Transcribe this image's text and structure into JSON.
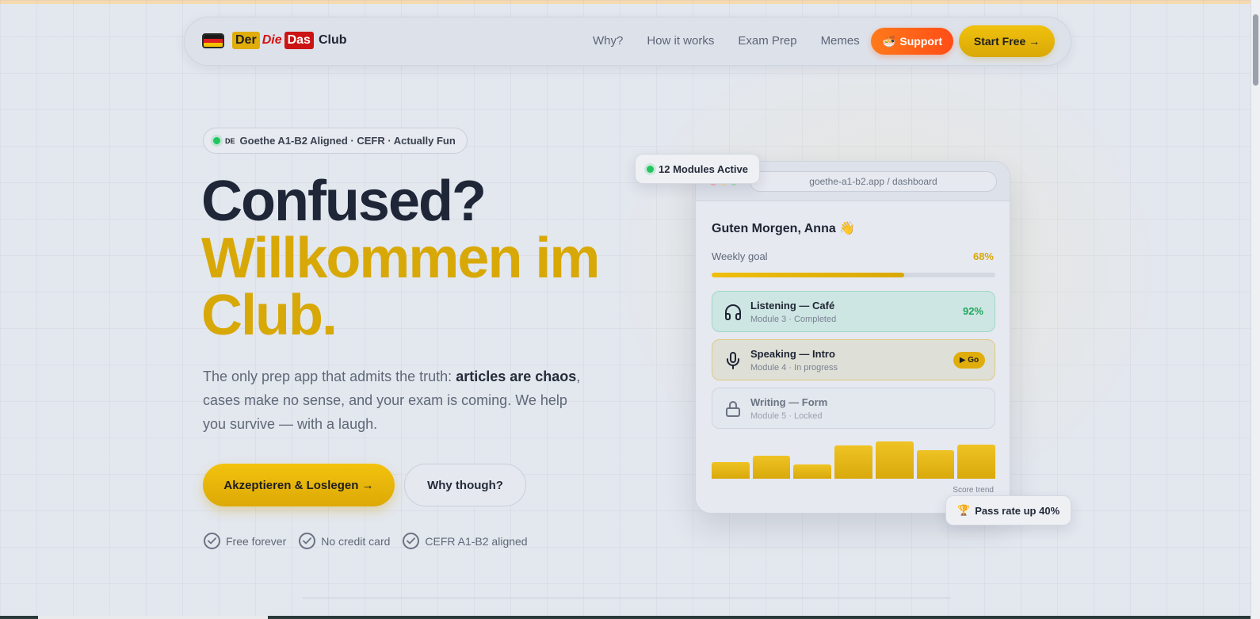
{
  "brand": {
    "der": "Der",
    "die": "Die",
    "das": "Das",
    "club": "Club",
    "flag_colors": [
      "#1a1a1a",
      "#dd1f1f",
      "#f2c100"
    ]
  },
  "nav": {
    "links": [
      {
        "label": "Why?"
      },
      {
        "label": "How it works"
      },
      {
        "label": "Exam Prep"
      },
      {
        "label": "Memes"
      }
    ],
    "support_icon": "🍜",
    "support_label": "Support",
    "start_label": "Start Free →"
  },
  "hero": {
    "pill_flag": "DE",
    "pill_text": "Goethe A1-B2 Aligned · CEFR · Actually Fun",
    "title_line1": "Confused?",
    "title_line2": "Willkommen im",
    "title_line3": "Club.",
    "lead_1": "The only prep app that admits the truth: ",
    "lead_bold": "articles are chaos",
    "lead_2": ", cases make no sense, and your exam is coming. We help you survive — with a laugh.",
    "primary_cta": "Akzeptieren & Loslegen →",
    "secondary_cta": "Why though?",
    "checks": [
      {
        "label": "Free forever"
      },
      {
        "label": "No credit card"
      },
      {
        "label": "CEFR A1-B2 aligned"
      }
    ]
  },
  "dashboard": {
    "url": "goethe-a1-b2.app / dashboard",
    "greeting": "Guten Morgen, Anna 👋",
    "weekly_goal_label": "Weekly goal",
    "weekly_goal_value": "68%",
    "weekly_goal_fraction": 0.68,
    "modules": [
      {
        "title": "Listening — Café",
        "subtitle": "Module 3 · Completed",
        "score": "92%",
        "icon": "headphones-icon"
      },
      {
        "title": "Speaking — Intro",
        "subtitle": "Module 4 · In progress",
        "action": "▶ Go",
        "icon": "microphone-icon"
      },
      {
        "title": "Writing — Form",
        "subtitle": "Module 5 · Locked",
        "icon": "lock-icon"
      }
    ],
    "score_trend_label": "Score trend",
    "score_trend": [
      0.44,
      0.6,
      0.38,
      0.88,
      0.98,
      0.75,
      0.9
    ]
  },
  "badges": {
    "modules_active": "12 Modules Active",
    "pass_icon": "🏆",
    "pass_rate": "Pass rate up 40%"
  },
  "colors": {
    "accent_yellow": "#d8a807",
    "support_orange": "#ff5a17",
    "status_green": "#22c55e"
  }
}
